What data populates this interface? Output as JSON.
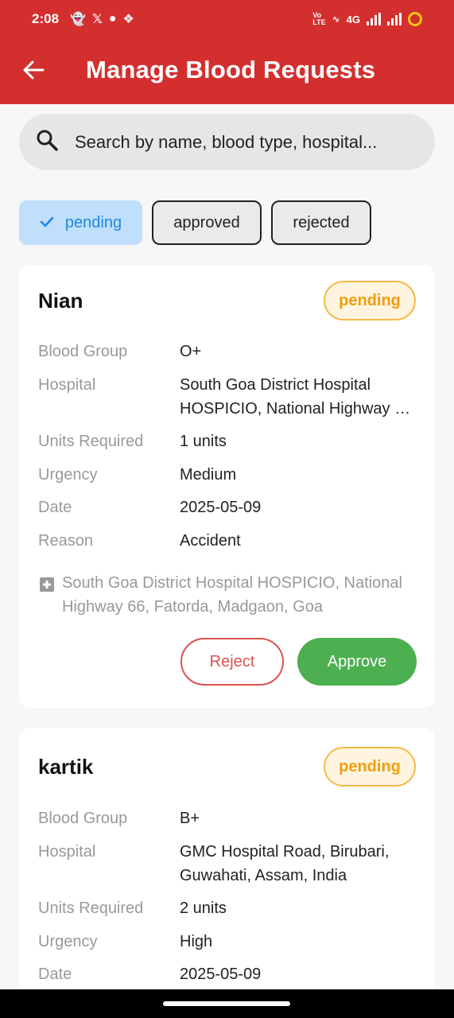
{
  "statusbar": {
    "time": "2:08",
    "network": "4G"
  },
  "header": {
    "title": "Manage Blood Requests"
  },
  "search": {
    "placeholder": "Search by name, blood type, hospital..."
  },
  "filters": [
    {
      "label": "pending",
      "selected": true
    },
    {
      "label": "approved",
      "selected": false
    },
    {
      "label": "rejected",
      "selected": false
    }
  ],
  "labels": {
    "blood_group": "Blood Group",
    "hospital": "Hospital",
    "units": "Units Required",
    "urgency": "Urgency",
    "date": "Date",
    "reason": "Reason"
  },
  "requests": [
    {
      "name": "Nian",
      "status": "pending",
      "blood_group": "O+",
      "hospital": "South Goa District Hospital HOSPICIO, National Highway 66, Fatorda, Madgaon, Goa",
      "units": "1 units",
      "urgency": "Medium",
      "date": "2025-05-09",
      "reason": "Accident",
      "address": "South Goa District Hospital HOSPICIO, National Highway 66, Fatorda, Madgaon, Goa",
      "reject_label": "Reject",
      "approve_label": "Approve"
    },
    {
      "name": "kartik",
      "status": "pending",
      "blood_group": "B+",
      "hospital": "GMC Hospital Road, Birubari, Guwahati, Assam, India",
      "units": "2 units",
      "urgency": "High",
      "date": "2025-05-09"
    }
  ],
  "colors": {
    "primary": "#d32f2f",
    "pending": "#f29d0c",
    "approve": "#4caf50",
    "reject": "#d9534f",
    "chip_selected": "#bfdffb"
  }
}
